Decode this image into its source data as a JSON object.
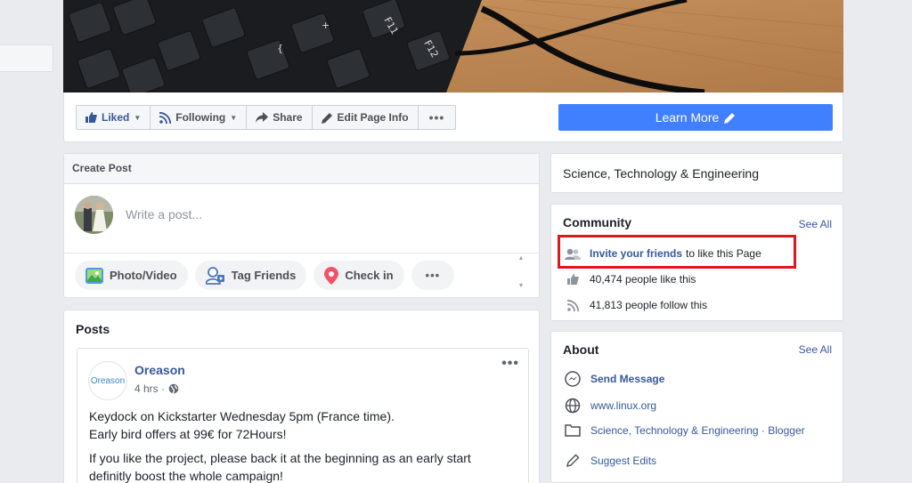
{
  "actions": {
    "liked": "Liked",
    "following": "Following",
    "share": "Share",
    "edit_info": "Edit Page Info",
    "more": "•••",
    "learn_more": "Learn More"
  },
  "create_post": {
    "title": "Create Post",
    "placeholder": "Write a post...",
    "buttons": {
      "photo_video": "Photo/Video",
      "tag_friends": "Tag Friends",
      "check_in": "Check in",
      "more": "•••"
    }
  },
  "posts": {
    "title": "Posts",
    "item": {
      "author": "Oreason",
      "logo_text": "Oreason",
      "time": "4 hrs ·",
      "more": "•••",
      "line1": "Keydock on Kickstarter Wednesday 5pm (France time).",
      "line2": "Early bird offers at 99€ for 72Hours!",
      "line3": "If you like the project, please back it at the beginning as an early start",
      "line4": "definitly boost the whole campaign!"
    }
  },
  "category": "Science, Technology & Engineering",
  "community": {
    "title": "Community",
    "see_all": "See All",
    "invite_link": "Invite your friends",
    "invite_rest": "to like this Page",
    "likes": "40,474 people like this",
    "follows": "41,813 people follow this"
  },
  "about": {
    "title": "About",
    "see_all": "See All",
    "send_message": "Send Message",
    "website": "www.linux.org",
    "category_link": "Science, Technology & Engineering",
    "category_sep": " · ",
    "category_blogger": "Blogger",
    "suggest_edits": "Suggest Edits"
  },
  "colors": {
    "accent": "#4080ff",
    "link": "#365899",
    "highlight": "#e0161f"
  }
}
